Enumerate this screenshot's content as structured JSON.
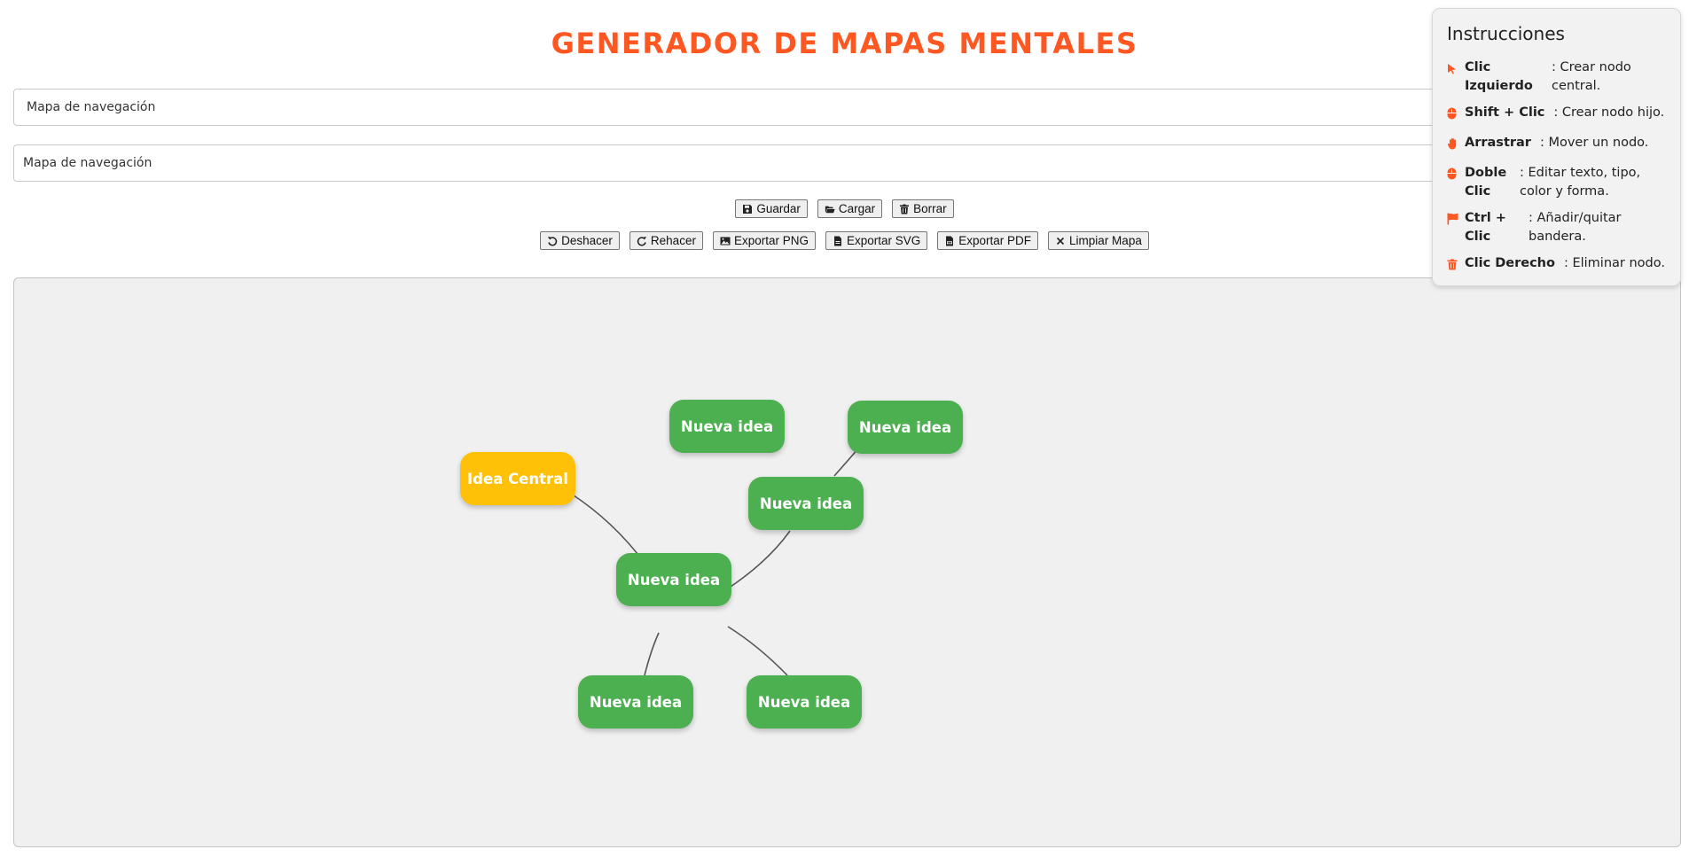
{
  "title": "GENERADOR DE MAPAS MENTALES",
  "inputs": [
    {
      "value": "Mapa de navegación"
    },
    {
      "value": "Mapa de navegación"
    }
  ],
  "toolbar_top": [
    {
      "label": "Guardar",
      "icon": "save-icon"
    },
    {
      "label": "Cargar",
      "icon": "folder-open-icon"
    },
    {
      "label": "Borrar",
      "icon": "trash-icon"
    }
  ],
  "toolbar_bottom": [
    {
      "label": "Deshacer",
      "icon": "undo-icon"
    },
    {
      "label": "Rehacer",
      "icon": "redo-icon"
    },
    {
      "label": "Exportar PNG",
      "icon": "image-icon"
    },
    {
      "label": "Exportar SVG",
      "icon": "file-icon"
    },
    {
      "label": "Exportar PDF",
      "icon": "file-pdf-icon"
    },
    {
      "label": "Limpiar Mapa",
      "icon": "close-icon"
    }
  ],
  "nodes": [
    {
      "label": "Idea Central",
      "type": "central"
    },
    {
      "label": "Nueva idea",
      "type": "child"
    },
    {
      "label": "Nueva idea",
      "type": "child"
    },
    {
      "label": "Nueva idea",
      "type": "child"
    },
    {
      "label": "Nueva idea",
      "type": "child"
    },
    {
      "label": "Nueva idea",
      "type": "child"
    },
    {
      "label": "Nueva idea",
      "type": "child"
    }
  ],
  "instructions": {
    "title": "Instrucciones",
    "items": [
      {
        "key": "Clic Izquierdo",
        "desc": ": Crear nodo central.",
        "icon": "cursor-icon"
      },
      {
        "key": "Shift + Clic",
        "desc": ": Crear nodo hijo.",
        "icon": "mouse-icon"
      },
      {
        "key": "Arrastrar",
        "desc": ": Mover un nodo.",
        "icon": "hand-icon"
      },
      {
        "key": "Doble Clic",
        "desc": ": Editar texto, tipo, color y forma.",
        "icon": "mouse-icon"
      },
      {
        "key": "Ctrl + Clic",
        "desc": ": Añadir/quitar bandera.",
        "icon": "flag-icon"
      },
      {
        "key": "Clic Derecho",
        "desc": ": Eliminar nodo.",
        "icon": "trash-icon"
      }
    ]
  },
  "colors": {
    "accent": "#ff5722",
    "central_node": "#ffc107",
    "child_node": "#4caf50",
    "canvas": "#f0f0f0"
  }
}
